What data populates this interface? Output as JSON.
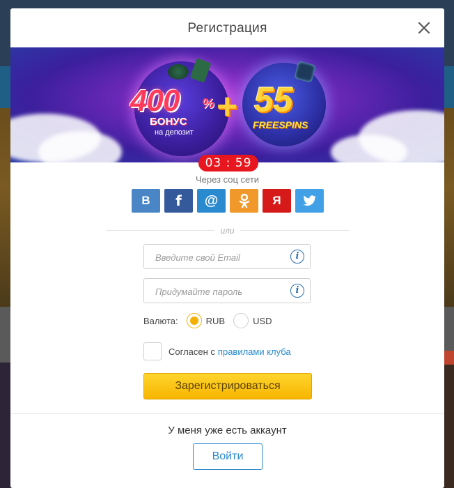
{
  "modal": {
    "title": "Регистрация"
  },
  "banner": {
    "percent": "400",
    "percent_sign": "%",
    "bonus": "БОНУС",
    "bonus_sub": "на депозит",
    "plus": "+",
    "spins_count": "55",
    "spins_label": "FREESPINS"
  },
  "timer": "03 : 59",
  "social": {
    "caption": "Через соц сети",
    "buttons": [
      {
        "name": "vk",
        "glyph": "В",
        "color": "#4a86c5"
      },
      {
        "name": "facebook",
        "glyph": "f",
        "color": "#355a9b"
      },
      {
        "name": "mailru",
        "glyph": "@",
        "color": "#2a8ad0"
      },
      {
        "name": "odnoklassniki",
        "glyph": "ok-icon",
        "color": "#f0982a"
      },
      {
        "name": "yandex",
        "glyph": "Я",
        "color": "#d61a1a"
      },
      {
        "name": "twitter",
        "glyph": "twitter-icon",
        "color": "#42a1e6"
      }
    ]
  },
  "divider": "или",
  "form": {
    "email_placeholder": "Введите свой Email",
    "password_placeholder": "Придумайте пароль",
    "info_glyph": "i",
    "currency_label": "Валюта:",
    "currency_options": [
      "RUB",
      "USD"
    ],
    "currency_selected": "RUB",
    "agree_text": "Согласен с",
    "rules_link": "правилами клуба",
    "register_label": "Зарегистрироваться"
  },
  "footer": {
    "have_account": "У меня уже есть аккаунт",
    "login_label": "Войти"
  },
  "colors": {
    "accent": "#2a8ad0",
    "register": "#f7b500",
    "timer": "#e8161e"
  }
}
